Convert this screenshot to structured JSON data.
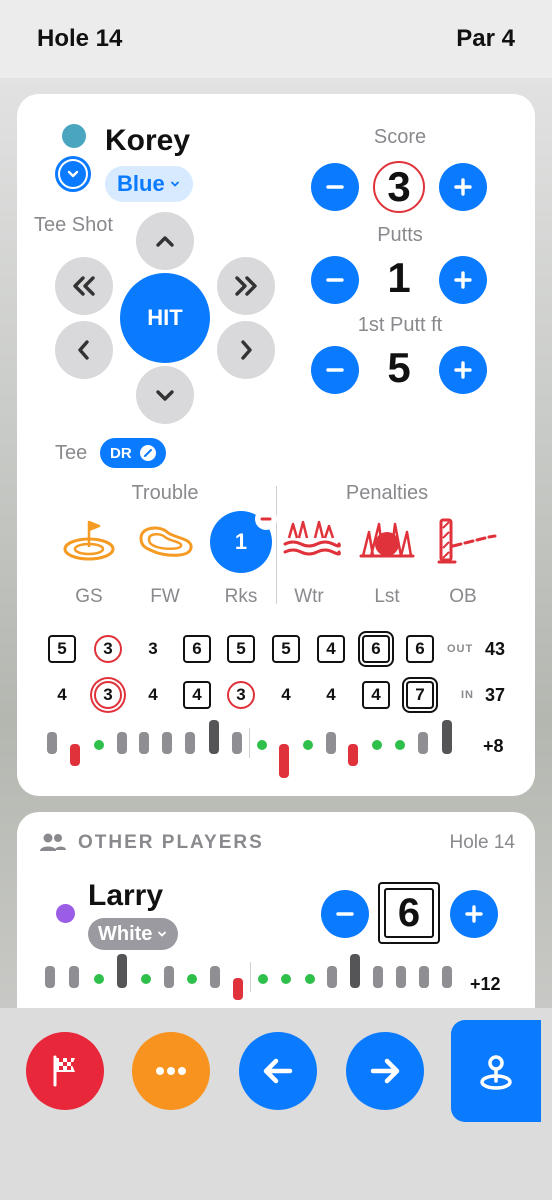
{
  "header": {
    "hole": "Hole 14",
    "par": "Par 4"
  },
  "player": {
    "name": "Korey",
    "tee": "Blue",
    "color": "#4aa6c0",
    "tee_shot_label": "Tee Shot",
    "hit_label": "HIT",
    "tee_label": "Tee",
    "club": "DR"
  },
  "stats": {
    "score_label": "Score",
    "score": "3",
    "putts_label": "Putts",
    "putts": "1",
    "first_putt_label": "1st Putt ft",
    "first_putt": "5"
  },
  "trouble": {
    "title": "Trouble",
    "items": [
      {
        "label": "GS"
      },
      {
        "label": "FW"
      },
      {
        "label": "Rks",
        "count": "1"
      }
    ]
  },
  "penalties": {
    "title": "Penalties",
    "items": [
      {
        "label": "Wtr"
      },
      {
        "label": "Lst"
      },
      {
        "label": "OB"
      }
    ]
  },
  "scorecard": {
    "out": {
      "tag": "OUT",
      "total": "43",
      "scores": [
        "5",
        "3",
        "3",
        "6",
        "5",
        "5",
        "4",
        "6",
        "6"
      ]
    },
    "in": {
      "tag": "IN",
      "total": "37",
      "scores": [
        "4",
        "3",
        "4",
        "4",
        "3",
        "4",
        "4",
        "4",
        "7"
      ]
    },
    "relative": "+8"
  },
  "other_players": {
    "title": "OTHER PLAYERS",
    "hole": "Hole 14",
    "players": [
      {
        "name": "Larry",
        "tee": "White",
        "score": "6",
        "relative": "+12",
        "color": "#9b5de5"
      }
    ]
  },
  "colors": {
    "accent": "#0a7aff",
    "red": "#e0323a",
    "orange": "#f59a23",
    "green": "#2ec04a"
  }
}
